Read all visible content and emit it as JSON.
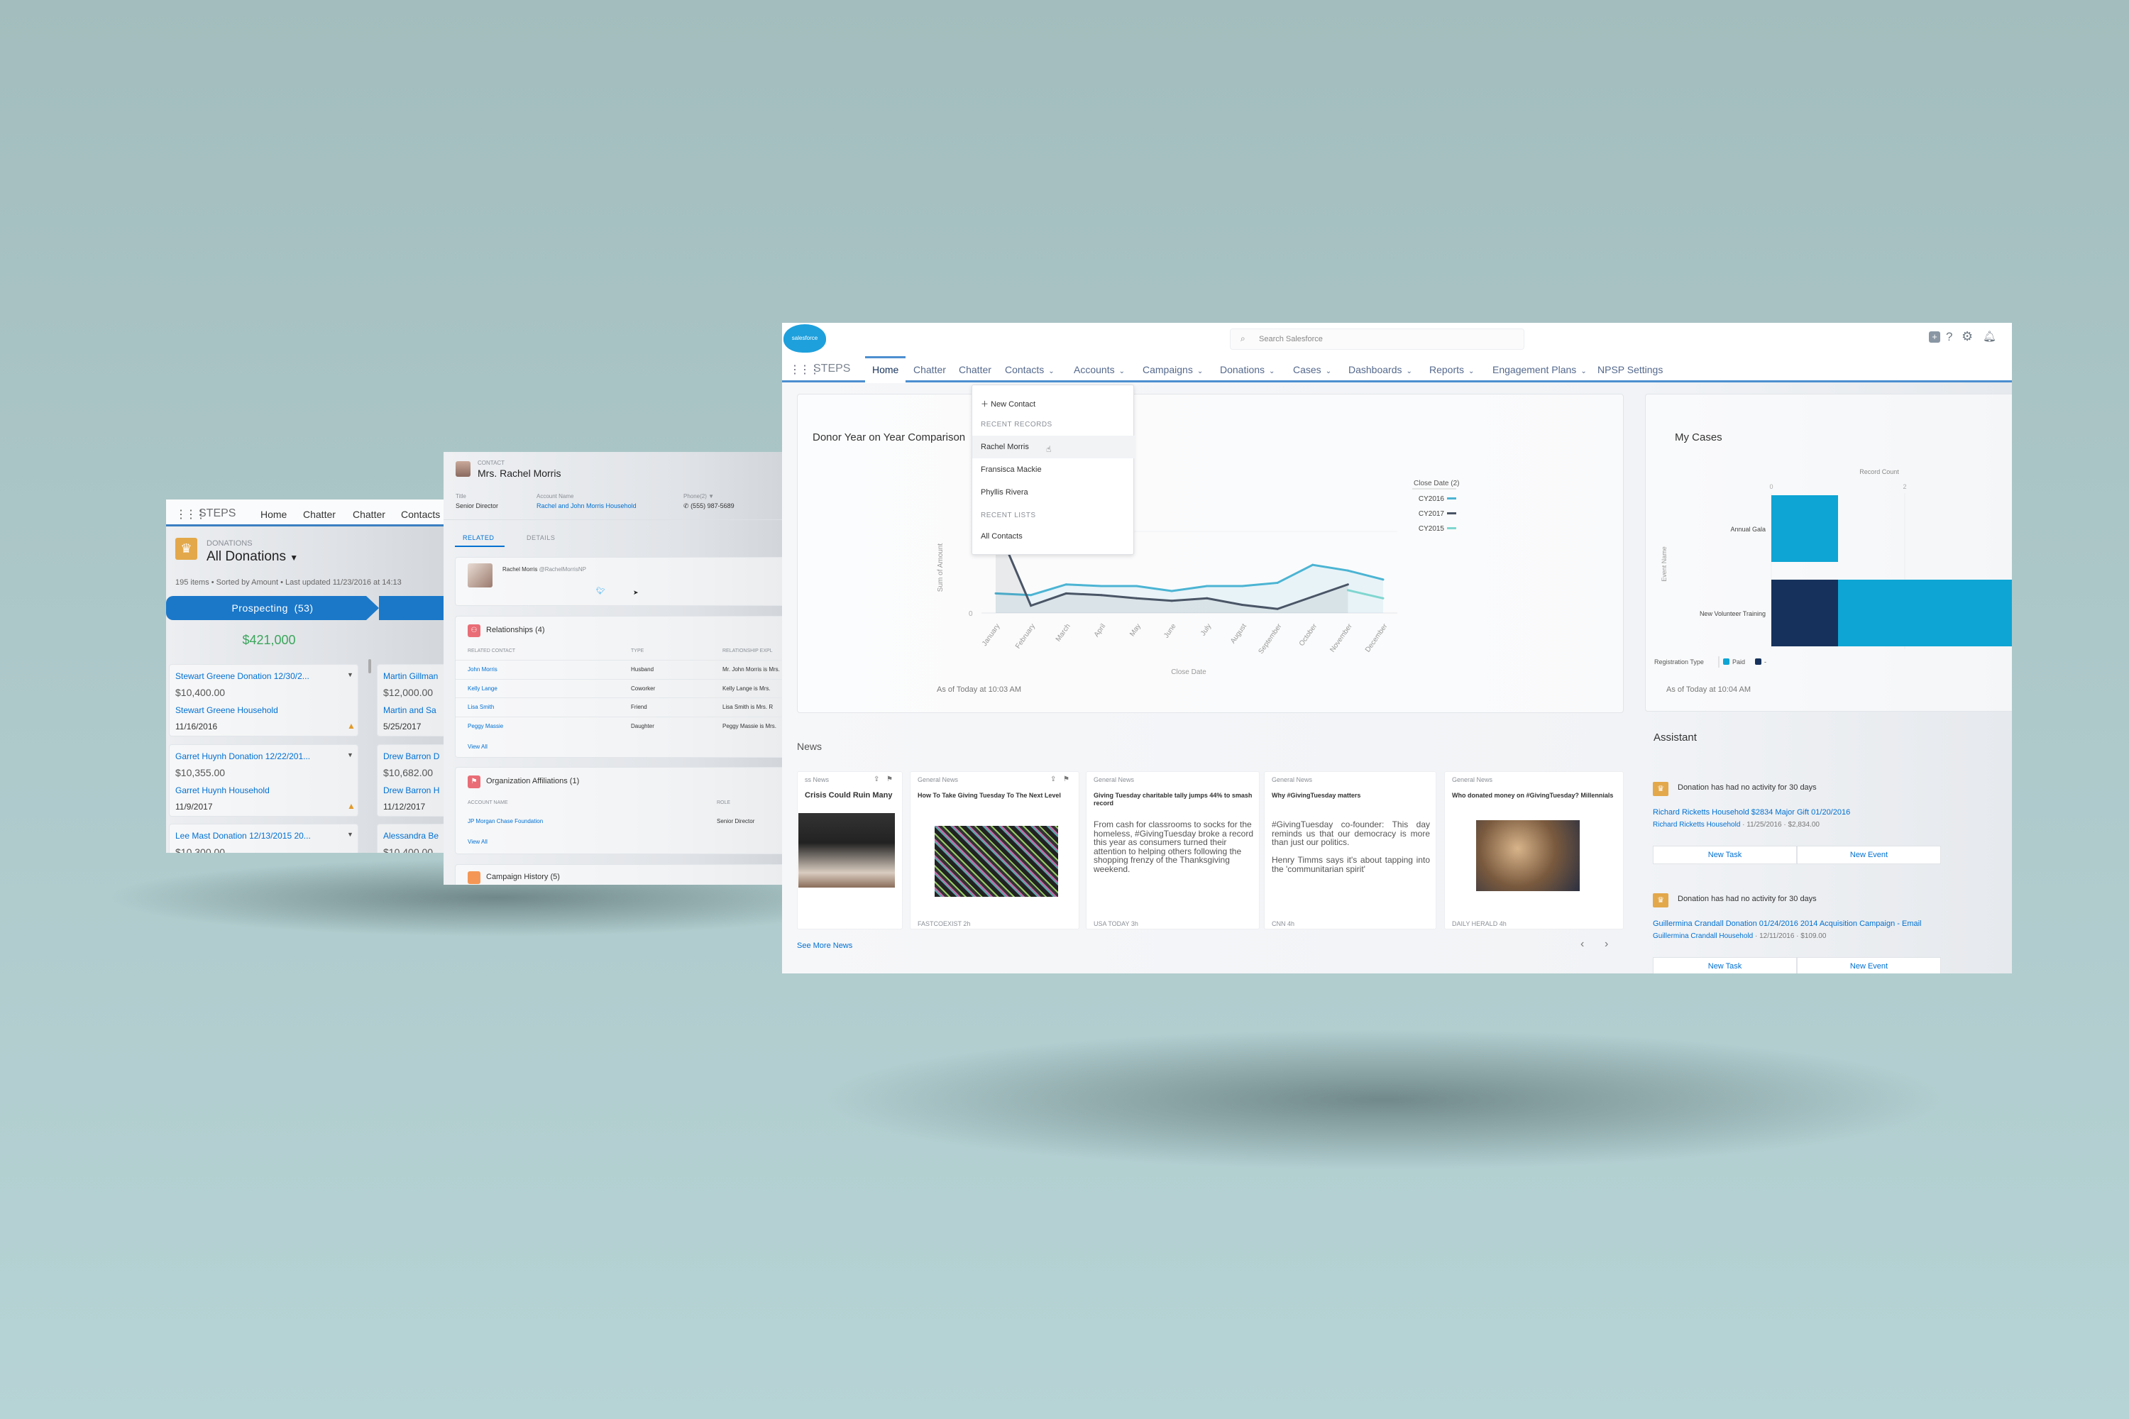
{
  "left_window": {
    "app_name": "STEPS",
    "nav": [
      "Home",
      "Chatter",
      "Chatter",
      "Contacts"
    ],
    "object_label": "DONATIONS",
    "list_view": "All Donations",
    "list_meta": "195 items • Sorted by Amount • Last updated 11/23/2016 at 14:13",
    "stage": "Prospecting",
    "stage_count": "(53)",
    "stage_total": "$421,000",
    "cards": [
      {
        "name": "Stewart Greene Donation 12/30/2...",
        "amount": "$10,400.00",
        "account": "Stewart Greene Household",
        "date": "11/16/2016"
      },
      {
        "name": "Garret Huynh Donation 12/22/201...",
        "amount": "$10,355.00",
        "account": "Garret Huynh Household",
        "date": "11/9/2017"
      },
      {
        "name": "Lee Mast Donation 12/13/2015 20...",
        "amount": "$10,300.00"
      }
    ],
    "cards_col2": [
      {
        "name": "Martin Gillman",
        "amount": "$12,000.00",
        "account": "Martin and Sa",
        "date": "5/25/2017"
      },
      {
        "name": "Drew Barron D",
        "amount": "$10,682.00",
        "account": "Drew Barron H",
        "date": "11/12/2017"
      },
      {
        "name": "Alessandra Be",
        "amount": "$10,400.00"
      }
    ]
  },
  "contact_window": {
    "object_label": "CONTACT",
    "name": "Mrs. Rachel Morris",
    "fields": [
      {
        "label": "Title",
        "value": "Senior Director"
      },
      {
        "label": "Account Name",
        "value": "Rachel and John Morris Household"
      },
      {
        "label": "Phone(2)",
        "value": "(555) 987-5689"
      }
    ],
    "tabs": [
      "RELATED",
      "DETAILS"
    ],
    "twitter_name": "Rachel Morris",
    "twitter_handle": "@RachelMorrisNP",
    "relationships": {
      "title": "Relationships (4)",
      "columns": [
        "RELATED CONTACT",
        "TYPE",
        "RELATIONSHIP EXPL"
      ],
      "rows": [
        [
          "John Morris",
          "Husband",
          "Mr. John Morris is Mrs."
        ],
        [
          "Kelly Lange",
          "Coworker",
          "Kelly Lange is Mrs."
        ],
        [
          "Lisa Smith",
          "Friend",
          "Lisa Smith is Mrs. R"
        ],
        [
          "Peggy Massie",
          "Daughter",
          "Peggy Massie is Mrs."
        ]
      ],
      "view_all": "View All"
    },
    "affiliations": {
      "title": "Organization Affiliations (1)",
      "columns": [
        "ACCOUNT NAME",
        "ROLE"
      ],
      "rows": [
        [
          "JP Morgan Chase Foundation",
          "Senior Director"
        ]
      ],
      "view_all": "View All"
    },
    "campaign_history": "Campaign History (5)"
  },
  "main_window": {
    "logo_text": "salesforce",
    "search_placeholder": "Search Salesforce",
    "app_name": "STEPS",
    "nav": [
      {
        "label": "Home",
        "dropdown": false,
        "active": true
      },
      {
        "label": "Chatter",
        "dropdown": false
      },
      {
        "label": "Chatter",
        "dropdown": false
      },
      {
        "label": "Contacts",
        "dropdown": true
      },
      {
        "label": "Accounts",
        "dropdown": true
      },
      {
        "label": "Campaigns",
        "dropdown": true
      },
      {
        "label": "Donations",
        "dropdown": true
      },
      {
        "label": "Cases",
        "dropdown": true
      },
      {
        "label": "Dashboards",
        "dropdown": true
      },
      {
        "label": "Reports",
        "dropdown": true
      },
      {
        "label": "Engagement Plans",
        "dropdown": true
      },
      {
        "label": "NPSP Settings",
        "dropdown": false
      }
    ],
    "contacts_menu": {
      "new_item": "New Contact",
      "recent_records_heading": "RECENT RECORDS",
      "recent_records": [
        "Rachel Morris",
        "Fransisca Mackie",
        "Phyllis Rivera"
      ],
      "recent_lists_heading": "RECENT LISTS",
      "recent_lists": [
        "All Contacts"
      ]
    },
    "donor_chart": {
      "title": "Donor Year on Year Comparison",
      "footer": "As of Today at 10:03 AM"
    },
    "my_cases": {
      "title": "My Cases",
      "footer": "As of Today at 10:04 AM"
    },
    "news": {
      "heading": "News",
      "items": [
        {
          "category": "ss News",
          "headline": "Crisis Could Ruin Many",
          "body": "",
          "source": ""
        },
        {
          "category": "General News",
          "headline": "How To Take Giving Tuesday To The Next Level",
          "body": "",
          "source": "FASTCOEXIST  2h"
        },
        {
          "category": "General News",
          "headline": "Giving Tuesday charitable tally jumps 44% to smash record",
          "body": "From cash for classrooms to socks for the homeless, #GivingTuesday broke a record this year as consumers turned their attention to helping others following the shopping frenzy of the Thanksgiving weekend.",
          "source": "USA TODAY  3h"
        },
        {
          "category": "General News",
          "headline": "Why #GivingTuesday matters",
          "body": "#GivingTuesday co-founder: This day reminds us that our democracy is more than just our politics.\n\nHenry Timms says it's about tapping into the 'communitarian spirit'",
          "source": "CNN  4h"
        },
        {
          "category": "General News",
          "headline": "Who donated money on #GivingTuesday? Millennials",
          "body": "",
          "source": "DAILY HERALD  4h"
        }
      ],
      "see_more": "See More News"
    },
    "assistant": {
      "heading": "Assistant",
      "items": [
        {
          "message": "Donation has had no activity for 30 days",
          "link": "Richard Ricketts Household $2834 Major Gift 01/20/2016",
          "account": "Richard Ricketts Household",
          "meta": " · 11/25/2016 · $2,834.00",
          "task": "New Task",
          "event": "New Event"
        },
        {
          "message": "Donation has had no activity for 30 days",
          "link": "Guillermina Crandall Donation 01/24/2016 2014 Acquisition Campaign - Email",
          "account": "Guillermina Crandall Household",
          "meta": " · 12/11/2016 · $109.00",
          "task": "New Task",
          "event": "New Event"
        }
      ]
    }
  },
  "chart_data": [
    {
      "type": "line",
      "title": "Donor Year on Year Comparison",
      "xlabel": "Close Date",
      "ylabel": "Sum of Amount",
      "categories": [
        "January",
        "February",
        "March",
        "April",
        "May",
        "June",
        "July",
        "August",
        "September",
        "October",
        "November",
        "December"
      ],
      "yticks": [
        "0"
      ],
      "ylim": [
        0,
        1.2
      ],
      "legend_title": "Close Date (2)",
      "legend_position": "right",
      "series": [
        {
          "name": "CY2016",
          "color": "#4bb4d3",
          "values": [
            0.24,
            0.22,
            0.35,
            0.33,
            0.33,
            0.27,
            0.33,
            0.33,
            0.37,
            0.59,
            0.52,
            0.41
          ]
        },
        {
          "name": "CY2017",
          "color": "#4a5566",
          "values": [
            1.1,
            0.09,
            0.24,
            0.22,
            0.18,
            0.15,
            0.18,
            0.1,
            0.05,
            0.2,
            0.35,
            null
          ]
        },
        {
          "name": "CY2015",
          "color": "#7fd6d0",
          "values": [
            null,
            null,
            null,
            null,
            null,
            null,
            null,
            null,
            null,
            null,
            0.28,
            0.18
          ]
        }
      ]
    },
    {
      "type": "bar",
      "orientation": "horizontal",
      "stacked": true,
      "xlabel": "Record Count",
      "ylabel": "Event Name",
      "xticks": [
        "0",
        "2"
      ],
      "categories": [
        "Annual Gala",
        "New Volunteer Training"
      ],
      "legend_title": "Registration Type",
      "series": [
        {
          "name": "-",
          "color": "#16325c",
          "values": [
            0,
            1
          ]
        },
        {
          "name": "Paid",
          "color": "#0ea5d4",
          "values": [
            1,
            4
          ]
        }
      ]
    }
  ]
}
